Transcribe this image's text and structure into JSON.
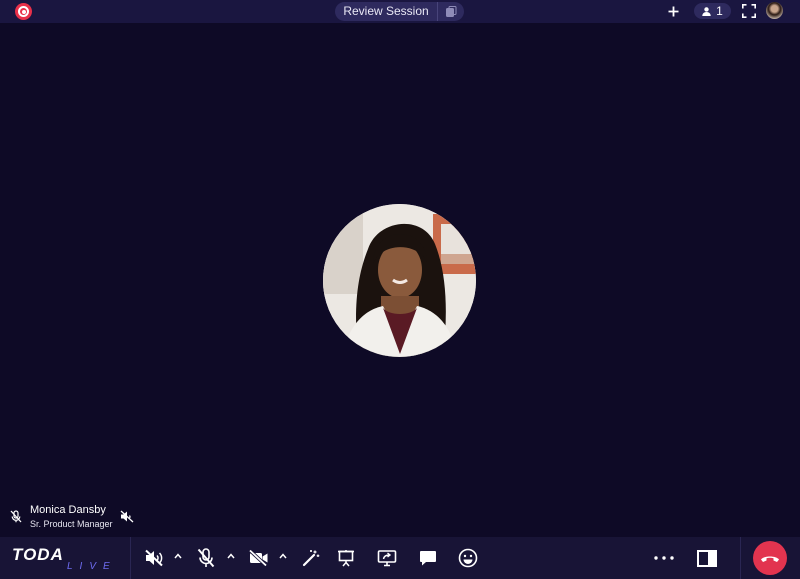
{
  "topbar": {
    "session_title": "Review Session",
    "participant_count": "1"
  },
  "stage": {
    "participant": {
      "name": "Monica Dansby",
      "role": "Sr. Product Manager"
    }
  },
  "bottombar": {
    "logo_text": "TODA",
    "logo_subtext": "LIVE"
  },
  "colors": {
    "background": "#0e0a26",
    "bar": "#181436",
    "record": "#e8304a",
    "end_call": "#e2344f",
    "accent": "#6e6cf0"
  },
  "icons": [
    "record-icon",
    "copy-icon",
    "plus-icon",
    "person-icon",
    "fullscreen-icon",
    "mic-off-icon",
    "speaker-off-icon",
    "camera-off-icon",
    "magic-wand-icon",
    "presentation-icon",
    "screen-share-icon",
    "chat-icon",
    "emoji-icon",
    "more-icon",
    "sidebar-toggle-icon",
    "hang-up-icon"
  ]
}
